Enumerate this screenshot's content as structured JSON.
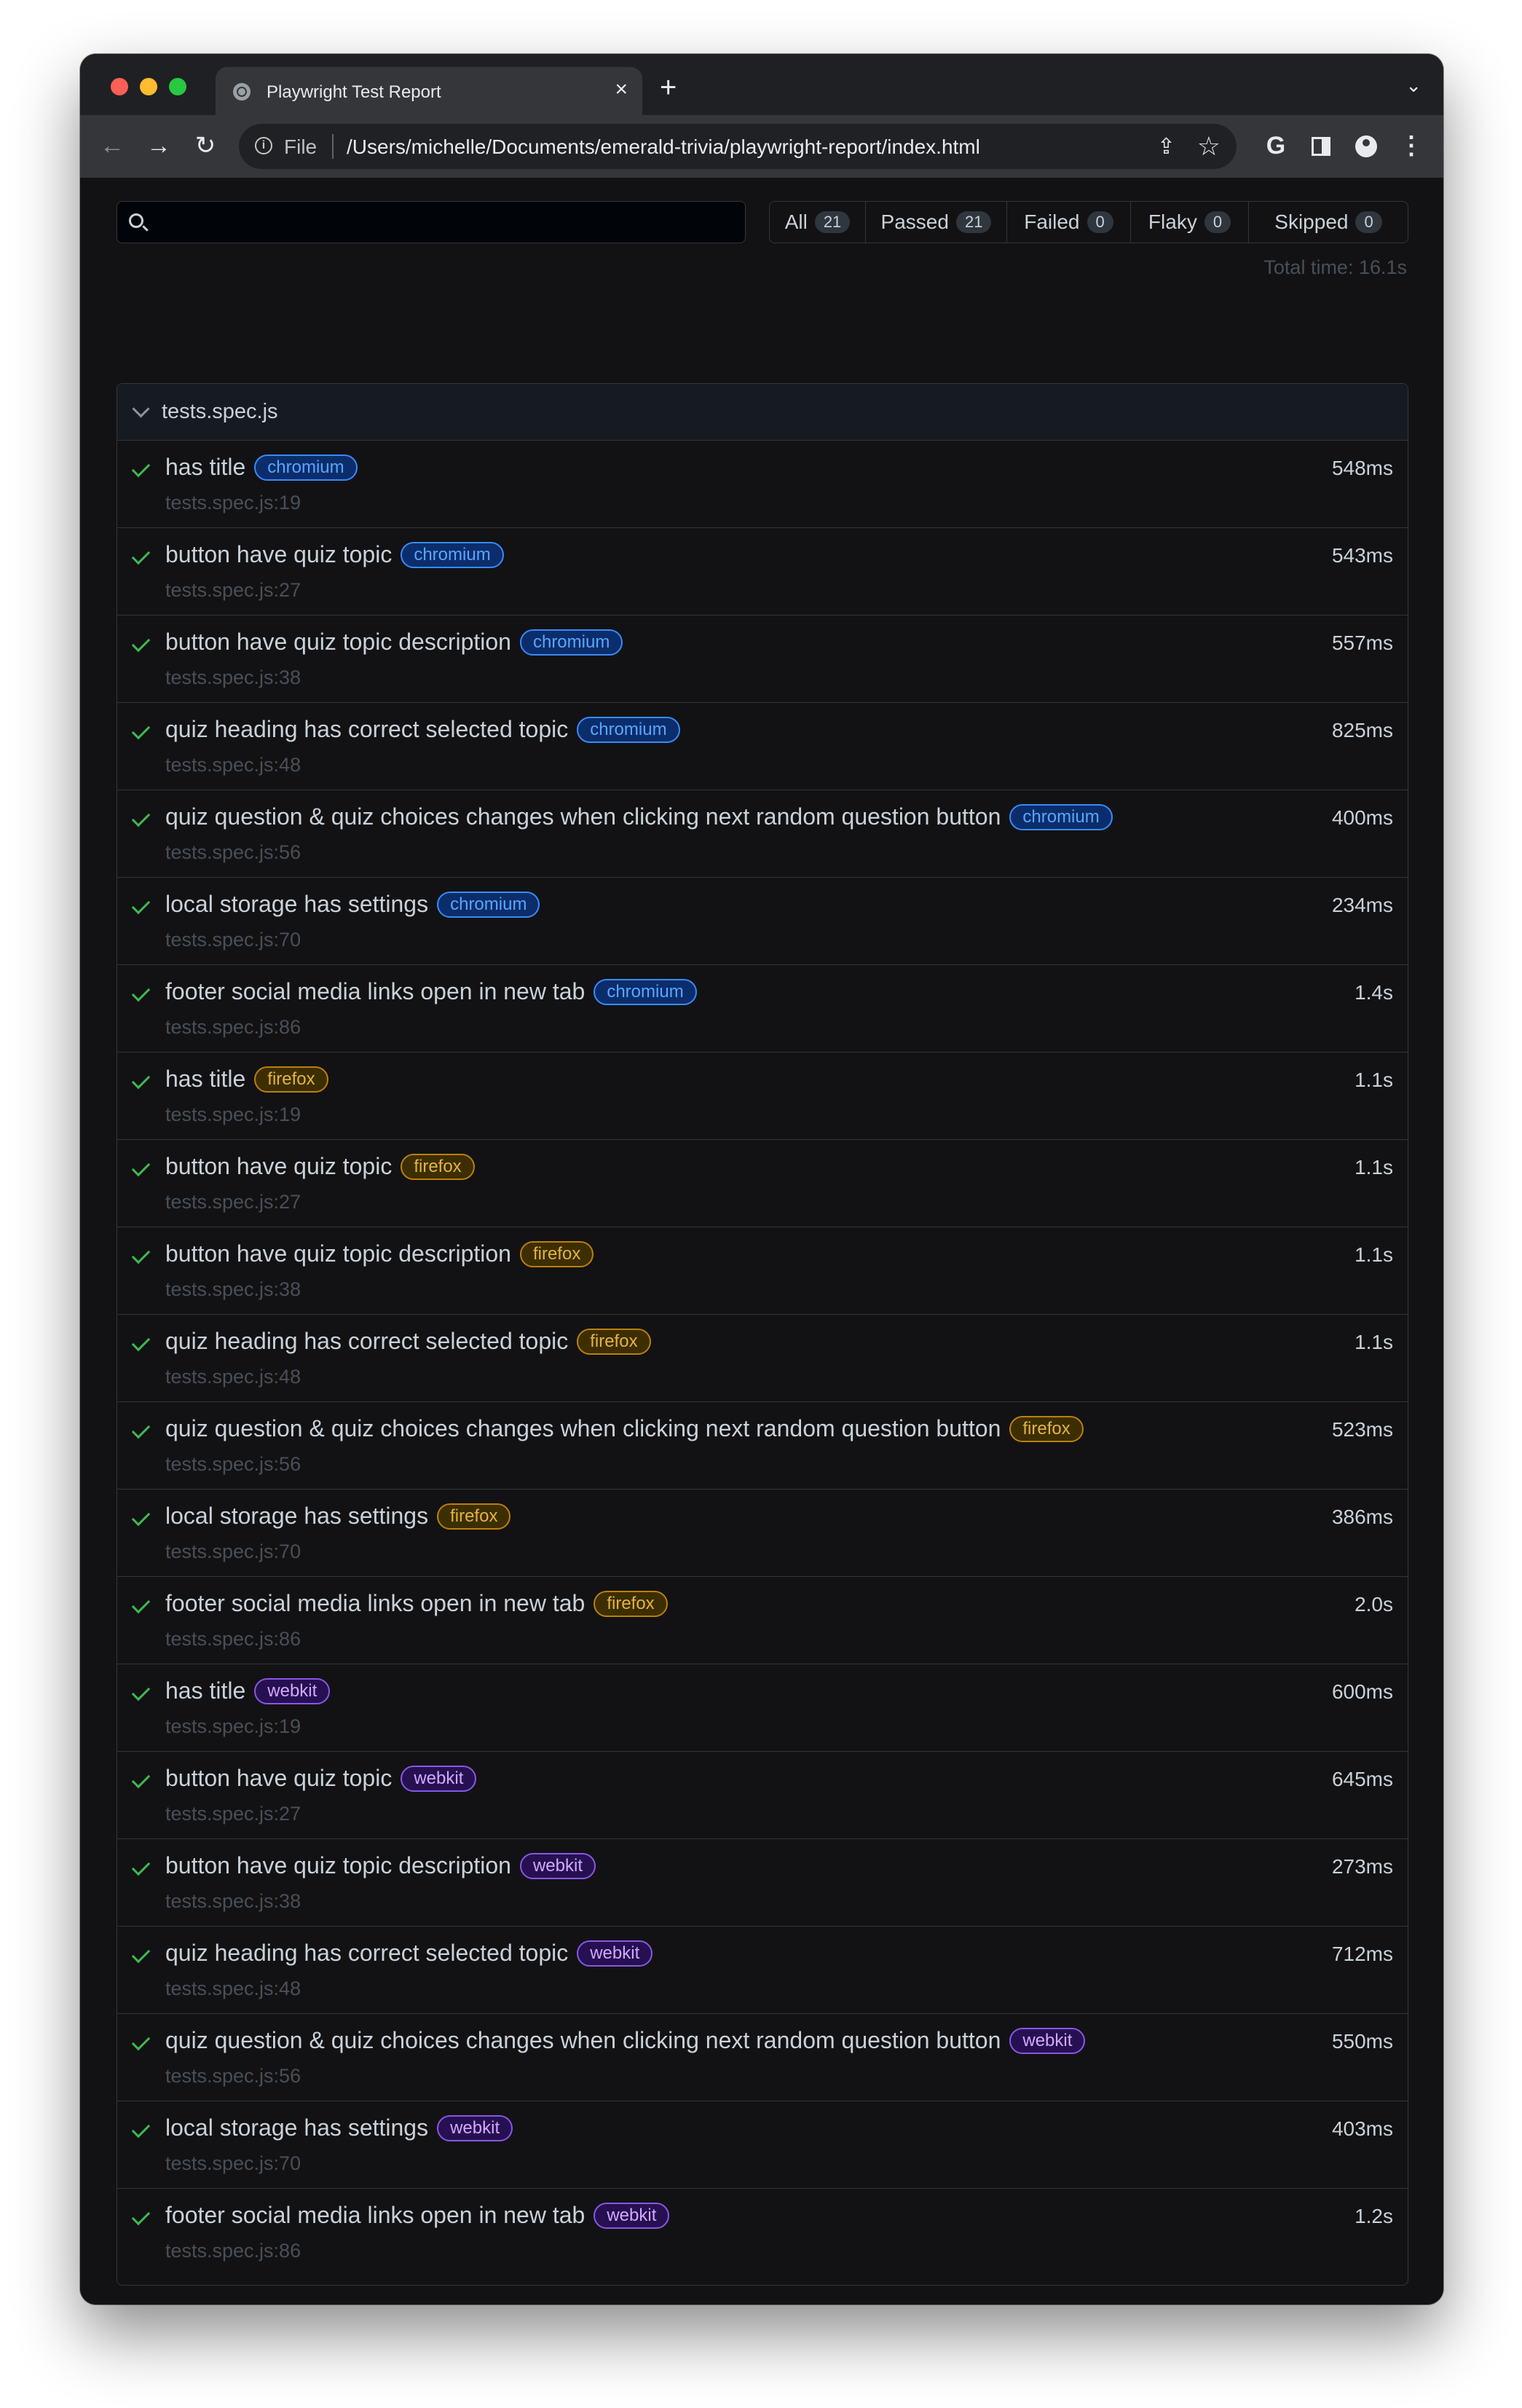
{
  "browser": {
    "tab_title": "Playwright Test Report",
    "tab_close": "×",
    "new_tab": "+",
    "tab_menu": "⌄",
    "address_label": "File",
    "url": "/Users/michelle/Documents/emerald-trivia/playwright-report/index.html",
    "back": "←",
    "forward": "→",
    "reload": "↻",
    "google": "G",
    "kebab": "⋮",
    "share": "⇪",
    "star": "☆"
  },
  "report": {
    "search_placeholder": "",
    "filters": [
      {
        "label": "All",
        "count": "21"
      },
      {
        "label": "Passed",
        "count": "21"
      },
      {
        "label": "Failed",
        "count": "0"
      },
      {
        "label": "Flaky",
        "count": "0"
      },
      {
        "label": "Skipped",
        "count": "0"
      }
    ],
    "total_time": "Total time: 16.1s",
    "suite_name": "tests.spec.js",
    "tests": [
      {
        "title": "has title",
        "project": "chromium",
        "location": "tests.spec.js:19",
        "duration": "548ms"
      },
      {
        "title": "button have quiz topic",
        "project": "chromium",
        "location": "tests.spec.js:27",
        "duration": "543ms"
      },
      {
        "title": "button have quiz topic description",
        "project": "chromium",
        "location": "tests.spec.js:38",
        "duration": "557ms"
      },
      {
        "title": "quiz heading has correct selected topic",
        "project": "chromium",
        "location": "tests.spec.js:48",
        "duration": "825ms"
      },
      {
        "title": "quiz question & quiz choices changes when clicking next random question button",
        "project": "chromium",
        "location": "tests.spec.js:56",
        "duration": "400ms"
      },
      {
        "title": "local storage has settings",
        "project": "chromium",
        "location": "tests.spec.js:70",
        "duration": "234ms"
      },
      {
        "title": "footer social media links open in new tab",
        "project": "chromium",
        "location": "tests.spec.js:86",
        "duration": "1.4s"
      },
      {
        "title": "has title",
        "project": "firefox",
        "location": "tests.spec.js:19",
        "duration": "1.1s"
      },
      {
        "title": "button have quiz topic",
        "project": "firefox",
        "location": "tests.spec.js:27",
        "duration": "1.1s"
      },
      {
        "title": "button have quiz topic description",
        "project": "firefox",
        "location": "tests.spec.js:38",
        "duration": "1.1s"
      },
      {
        "title": "quiz heading has correct selected topic",
        "project": "firefox",
        "location": "tests.spec.js:48",
        "duration": "1.1s"
      },
      {
        "title": "quiz question & quiz choices changes when clicking next random question button",
        "project": "firefox",
        "location": "tests.spec.js:56",
        "duration": "523ms"
      },
      {
        "title": "local storage has settings",
        "project": "firefox",
        "location": "tests.spec.js:70",
        "duration": "386ms"
      },
      {
        "title": "footer social media links open in new tab",
        "project": "firefox",
        "location": "tests.spec.js:86",
        "duration": "2.0s"
      },
      {
        "title": "has title",
        "project": "webkit",
        "location": "tests.spec.js:19",
        "duration": "600ms"
      },
      {
        "title": "button have quiz topic",
        "project": "webkit",
        "location": "tests.spec.js:27",
        "duration": "645ms"
      },
      {
        "title": "button have quiz topic description",
        "project": "webkit",
        "location": "tests.spec.js:38",
        "duration": "273ms"
      },
      {
        "title": "quiz heading has correct selected topic",
        "project": "webkit",
        "location": "tests.spec.js:48",
        "duration": "712ms"
      },
      {
        "title": "quiz question & quiz choices changes when clicking next random question button",
        "project": "webkit",
        "location": "tests.spec.js:56",
        "duration": "550ms"
      },
      {
        "title": "local storage has settings",
        "project": "webkit",
        "location": "tests.spec.js:70",
        "duration": "403ms"
      },
      {
        "title": "footer social media links open in new tab",
        "project": "webkit",
        "location": "tests.spec.js:86",
        "duration": "1.2s"
      }
    ]
  }
}
